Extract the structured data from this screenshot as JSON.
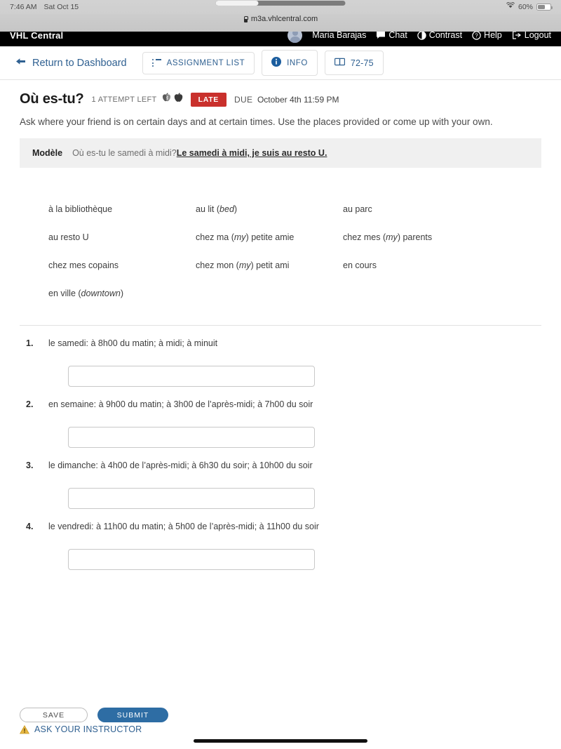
{
  "device": {
    "status_bar": {
      "time": "7:46 AM",
      "date": "Sat Oct 15",
      "wifi_icon": "wifi-icon",
      "battery_percent": "60%",
      "battery_icon": "battery-icon"
    },
    "browser": {
      "url": "m3a.vhlcentral.com",
      "lock_icon": "lock-icon"
    }
  },
  "site_header": {
    "brand": "VHL Central",
    "user_name": "Maria Barajas",
    "avatar": "user-avatar",
    "chat_label": "Chat",
    "chat_icon": "chat-icon",
    "contrast_label": "Contrast",
    "contrast_icon": "contrast-icon",
    "help_label": "Help",
    "help_icon": "help-icon",
    "logout_label": "Logout",
    "logout_icon": "logout-icon"
  },
  "toolbar": {
    "return_label": "Return to Dashboard",
    "return_icon": "back-arrow-icon",
    "assignment_list_label": "ASSIGNMENT LIST",
    "assignment_list_icon": "list-icon",
    "info_label": "INFO",
    "info_icon": "info-circle-icon",
    "pages_label": "72-75",
    "pages_icon": "book-icon"
  },
  "assignment": {
    "title": "Où es-tu?",
    "attempts": "1 ATTEMPT LEFT",
    "apple_icons": [
      "apple-partial-icon",
      "apple-full-icon"
    ],
    "status_badge": "LATE",
    "status_badge_color": "#c9302c",
    "due_label": "DUE",
    "due_date": "October 4th 11:59 PM",
    "directions": "Ask where your friend is on certain days and at certain times. Use the places provided or come up with your own.",
    "modele": {
      "label": "Modèle",
      "prompt": "Où es-tu le samedi à midi?",
      "answer": "Le samedi à midi, je suis au resto U."
    }
  },
  "word_bank": [
    {
      "text": "à la bibliothèque",
      "gloss": ""
    },
    {
      "text": "au lit ",
      "gloss": "bed"
    },
    {
      "text": "au parc",
      "gloss": ""
    },
    {
      "text": "au resto U",
      "gloss": ""
    },
    {
      "text": "chez ma ",
      "gloss": "my",
      "suffix": " petite amie"
    },
    {
      "text": "chez mes ",
      "gloss": "my",
      "suffix": " parents"
    },
    {
      "text": "chez mes copains",
      "gloss": ""
    },
    {
      "text": "chez mon ",
      "gloss": "my",
      "suffix": " petit ami"
    },
    {
      "text": "en cours",
      "gloss": ""
    },
    {
      "text": "en ville ",
      "gloss": "downtown"
    }
  ],
  "questions": [
    {
      "number": "1.",
      "prompt": "le samedi: à 8h00 du matin; à midi; à minuit",
      "answer": "",
      "placeholder": ""
    },
    {
      "number": "2.",
      "prompt": "en semaine: à 9h00 du matin; à 3h00 de l’après-midi; à 7h00 du soir",
      "answer": "",
      "placeholder": ""
    },
    {
      "number": "3.",
      "prompt": "le dimanche: à 4h00 de l’après-midi; à 6h30 du soir; à 10h00 du soir",
      "answer": "",
      "placeholder": ""
    },
    {
      "number": "4.",
      "prompt": "le vendredi: à 11h00 du matin; à 5h00 de l’après-midi; à 11h00 du soir",
      "answer": "",
      "placeholder": ""
    }
  ],
  "footer": {
    "save_label": "SAVE",
    "submit_label": "SUBMIT",
    "submit_color": "#2e6da4",
    "ask_label": "ASK YOUR INSTRUCTOR",
    "ask_icon": "warning-triangle-icon"
  }
}
